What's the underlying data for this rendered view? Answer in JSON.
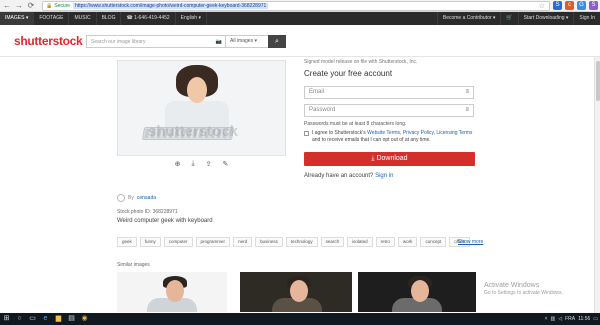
{
  "browser": {
    "back": "←",
    "forward": "→",
    "reload": "⟳",
    "secure_label": "Secure",
    "url": "https://www.shutterstock.com/image-photo/weird-computer-geek-keyboard-368228971",
    "extensions": [
      "S",
      "c",
      "G",
      "S"
    ]
  },
  "topnav": {
    "items": [
      "IMAGES ▾",
      "FOOTAGE",
      "MUSIC",
      "BLOG"
    ],
    "phone": "☎ 1-646-419-4452",
    "language": "English ▾",
    "right": [
      "Become a Contributor ▾",
      "🛒",
      "Start Downloading ▾",
      "Sign In"
    ]
  },
  "header": {
    "logo": "shutterstock",
    "search_placeholder": "Search our image library",
    "search_type": "All images ▾"
  },
  "photo": {
    "watermark": "shutterstock",
    "tools": [
      "⊕",
      "⤓",
      "⇪",
      "✎"
    ]
  },
  "signup": {
    "release_note": "Signed model release on file with Shutterstock, Inc.",
    "title": "Create your free account",
    "email_placeholder": "Email",
    "password_placeholder": "Password",
    "hint": "Passwords must be at least 8 characters long.",
    "agree_prefix": "I agree to Shutterstock's ",
    "agree_links": [
      "Website Terms",
      "Privacy Policy",
      "Licensing Terms"
    ],
    "agree_suffix": " and to receive emails that I can opt out of at any time.",
    "download_label": "⤓  Download",
    "already_text": "Already have an account?",
    "sign_in": "Sign in"
  },
  "details": {
    "by": "By",
    "author": "cenaada",
    "stock_id": "Stock photo ID: 368228971",
    "description": "Weird computer geek with keyboard",
    "tags": [
      "geek",
      "funny",
      "computer",
      "programmer",
      "nerd",
      "business",
      "technology",
      "search",
      "isolated",
      "retro",
      "work",
      "concept",
      "office"
    ],
    "show_more": "Show more",
    "similar_label": "Similar images"
  },
  "windows": {
    "activate_title": "Activate Windows",
    "activate_sub": "Go to Settings to activate Windows.",
    "language": "FRA",
    "time": "11:56"
  }
}
